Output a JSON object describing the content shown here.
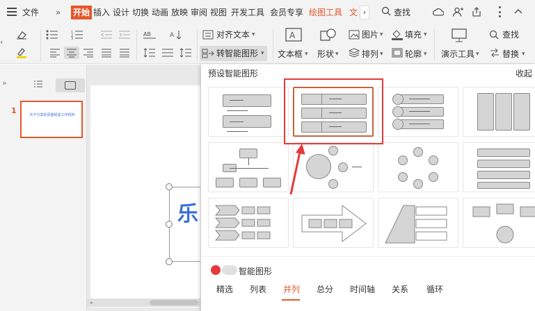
{
  "menu": {
    "hamburger_label": "文件",
    "more": "»",
    "tabs": [
      "开始",
      "插入",
      "设计",
      "切换",
      "动画",
      "放映",
      "审阅",
      "视图",
      "开发工具",
      "会员专享",
      "绘图工具",
      "文"
    ],
    "active_tab": "开始",
    "search": "查找"
  },
  "ribbon": {
    "align_text": "对齐文本",
    "convert_smartart": "转智能图形",
    "text_box": "文本框",
    "shape": "形状",
    "arrange": "排列",
    "picture": "图片",
    "fill": "填充",
    "outline": "轮廓",
    "present_tools": "演示工具",
    "find": "查找",
    "replace": "替换"
  },
  "slides": {
    "number": "1",
    "thumb_text": "乐于分享的百度经验工作机构"
  },
  "slide": {
    "title_fragment": "乐"
  },
  "panel": {
    "title": "预设智能图形",
    "collapse": "收起",
    "footer_title": "智能图形",
    "tabs": [
      "精选",
      "列表",
      "并列",
      "总分",
      "时间轴",
      "关系",
      "循环"
    ],
    "active_tab": "并列"
  },
  "colors": {
    "accent": "#e2582b",
    "highlight": "#e53a3a",
    "selected": "#c9633a"
  }
}
